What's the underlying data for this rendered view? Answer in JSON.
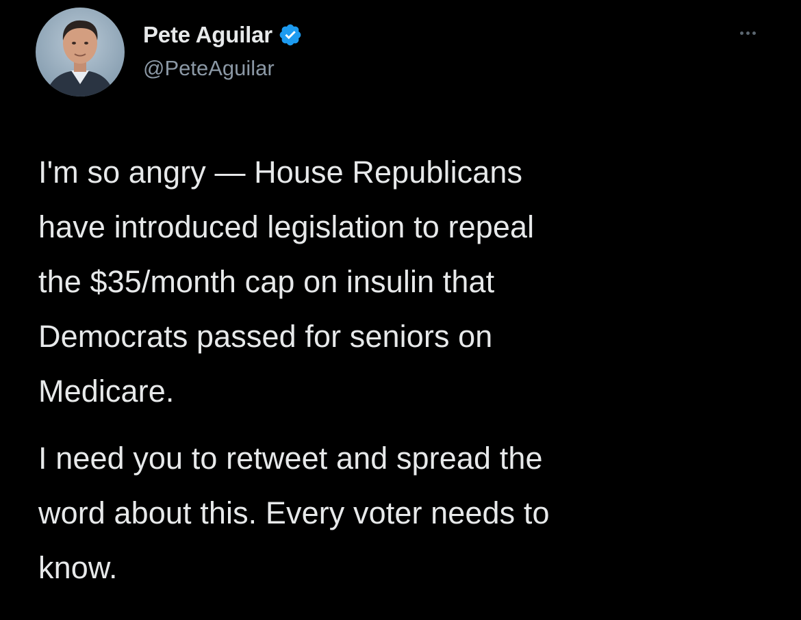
{
  "author": {
    "name": "Pete Aguilar",
    "handle": "@PeteAguilar",
    "verified": true
  },
  "icons": {
    "avatar": "profile-photo",
    "verified": "verified-badge-icon",
    "more": "more-options-icon"
  },
  "colors": {
    "background": "#000000",
    "text": "#e7e9ea",
    "secondary_text": "#8b98a5",
    "verified_blue": "#1d9bf0"
  },
  "tweet": {
    "paragraph1": [
      "I'm so angry — House Republicans",
      "have introduced legislation to repeal",
      "the $35/month cap on insulin that",
      "Democrats passed for seniors on",
      "Medicare."
    ],
    "paragraph2": [
      "I need you to retweet and spread the",
      "word about this. Every voter needs to",
      "know."
    ]
  }
}
